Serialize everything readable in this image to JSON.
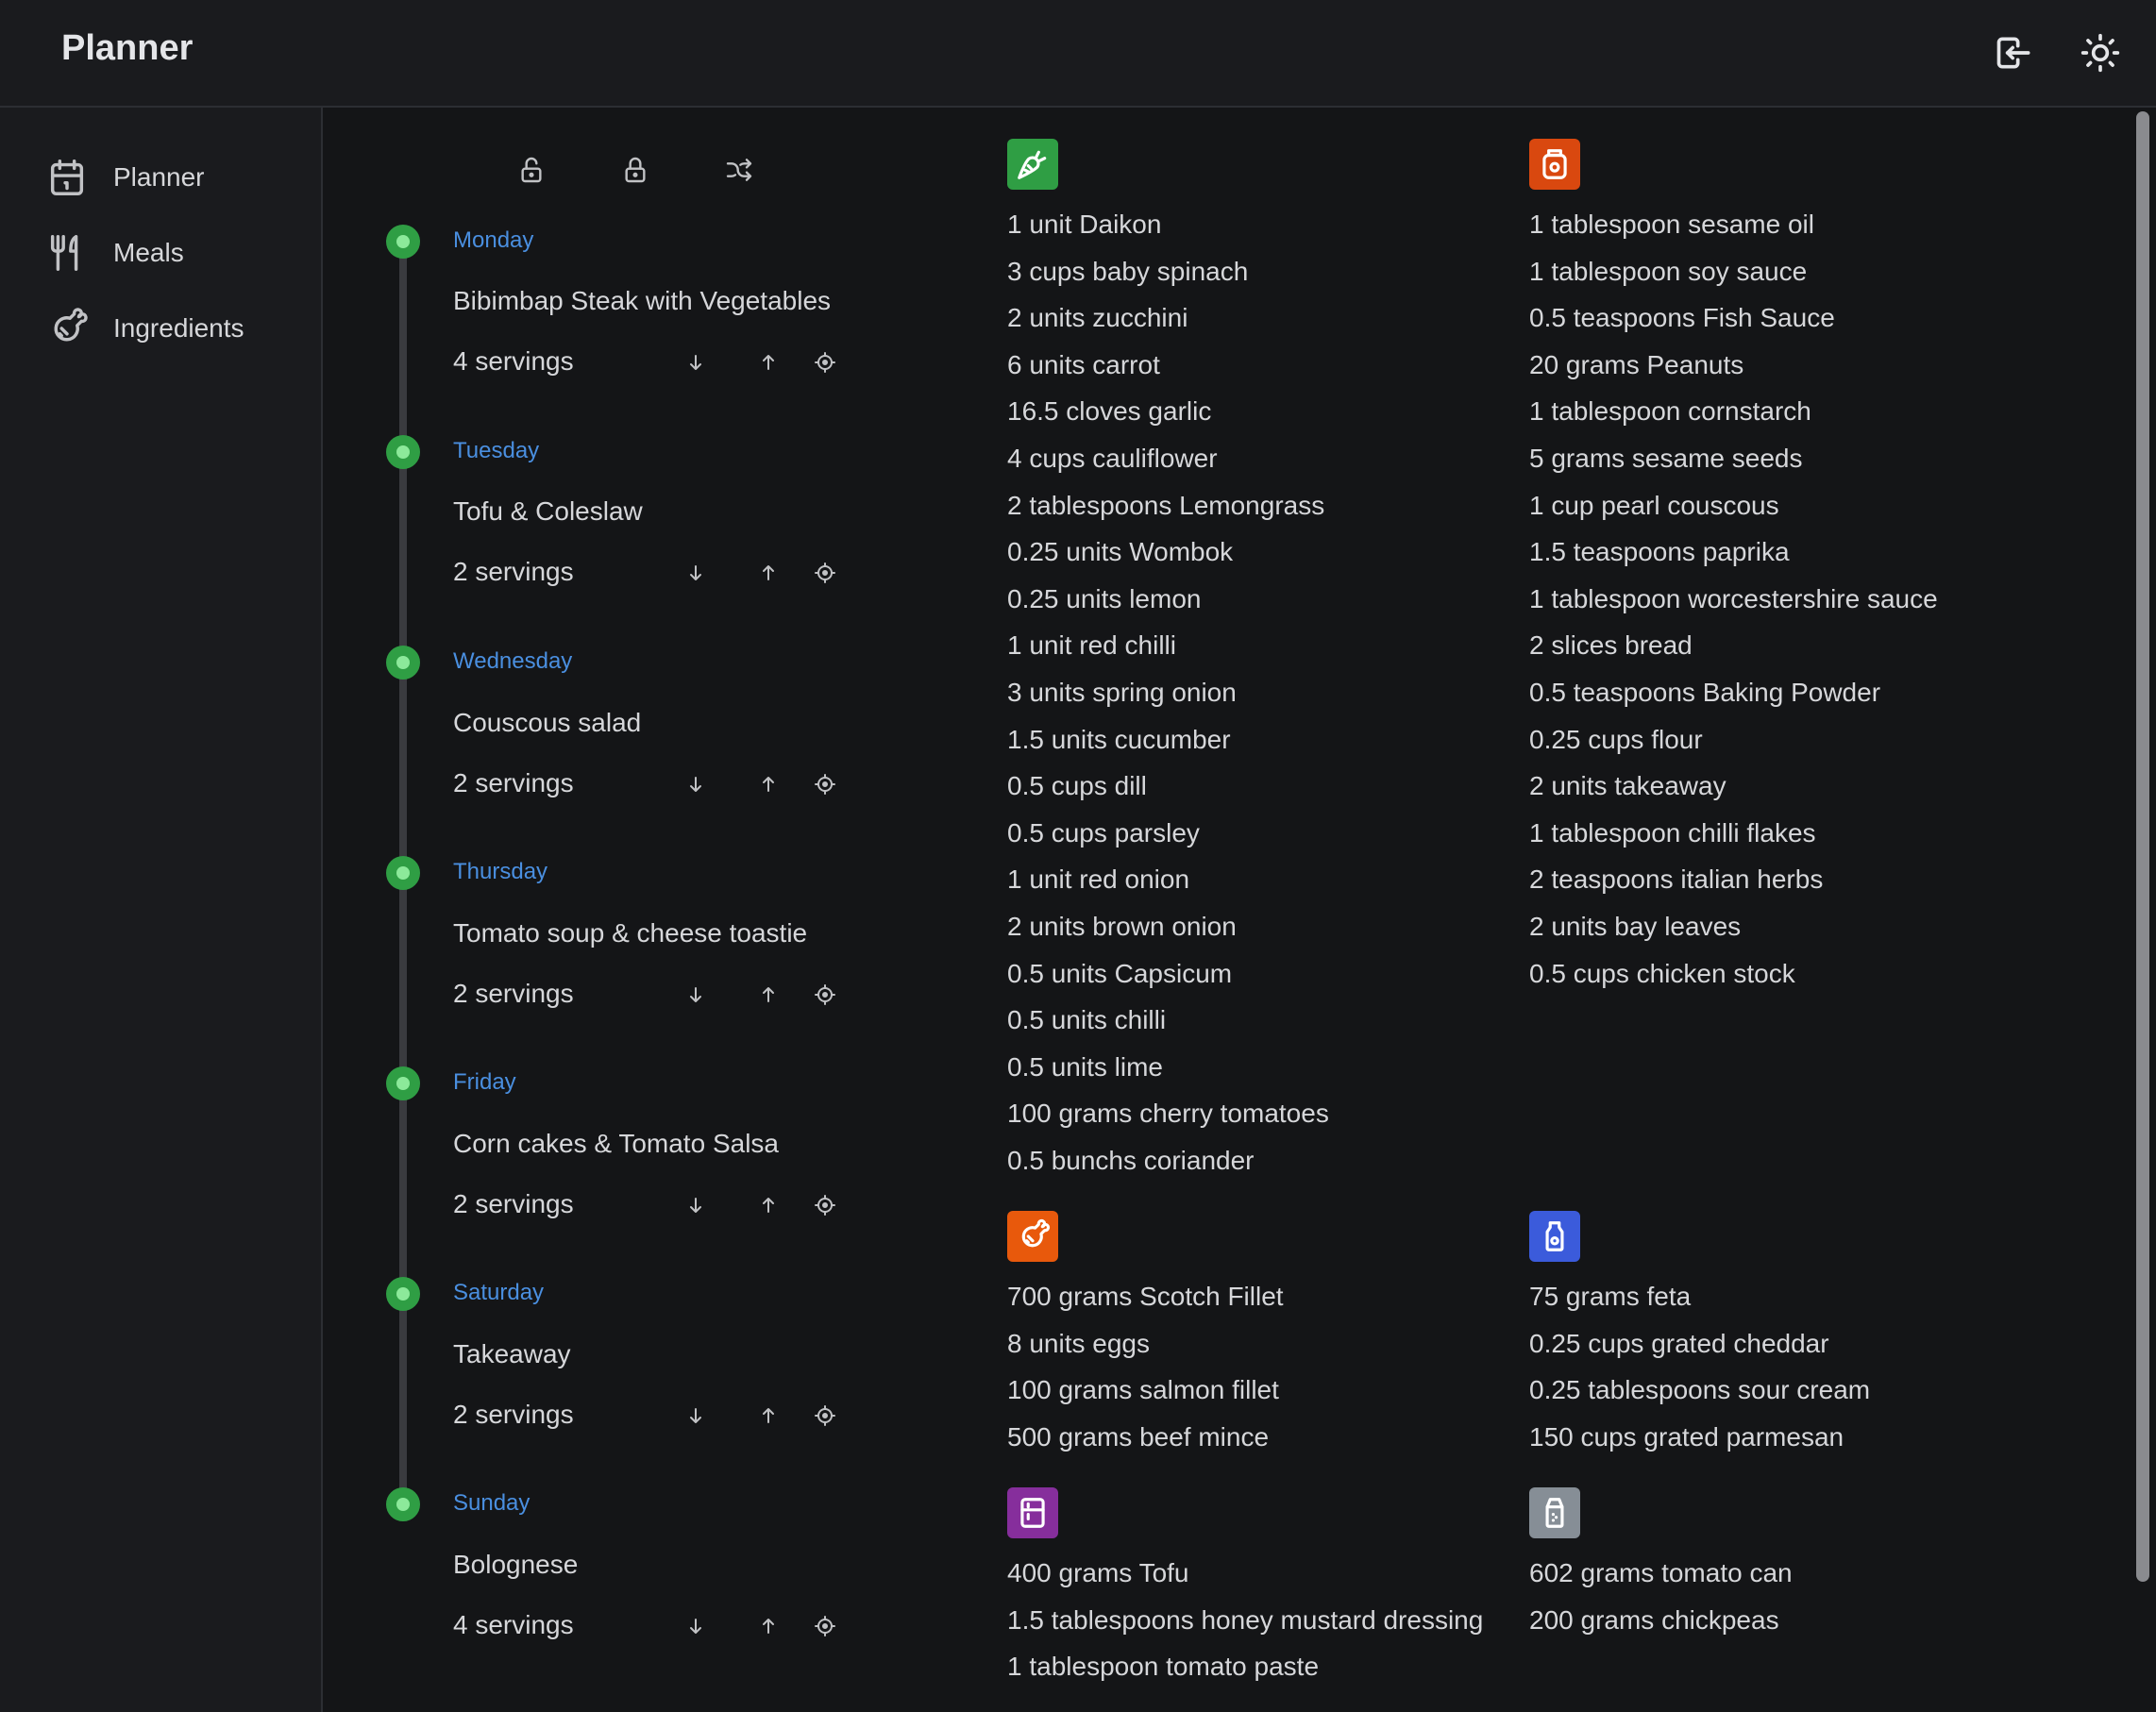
{
  "header": {
    "title": "Planner"
  },
  "sidebar": {
    "items": [
      {
        "label": "Planner",
        "icon": "calendar-icon"
      },
      {
        "label": "Meals",
        "icon": "fork-knife-icon"
      },
      {
        "label": "Ingredients",
        "icon": "meat-icon"
      }
    ]
  },
  "toolbar": {
    "icons": [
      "lock-open-icon",
      "lock-icon",
      "shuffle-icon"
    ]
  },
  "days": [
    {
      "day": "Monday",
      "meal": "Bibimbap Steak with Vegetables",
      "servings": "4 servings"
    },
    {
      "day": "Tuesday",
      "meal": "Tofu & Coleslaw",
      "servings": "2 servings"
    },
    {
      "day": "Wednesday",
      "meal": "Couscous salad",
      "servings": "2 servings"
    },
    {
      "day": "Thursday",
      "meal": "Tomato soup & cheese toastie",
      "servings": "2 servings"
    },
    {
      "day": "Friday",
      "meal": "Corn cakes & Tomato Salsa",
      "servings": "2 servings"
    },
    {
      "day": "Saturday",
      "meal": "Takeaway",
      "servings": "2 servings"
    },
    {
      "day": "Sunday",
      "meal": "Bolognese",
      "servings": "4 servings"
    }
  ],
  "categories": [
    {
      "icon": "carrot-icon",
      "color": "#2f9e44",
      "items": [
        "1 unit Daikon",
        "3 cups baby spinach",
        "2 units zucchini",
        "6 units carrot",
        "16.5 cloves garlic",
        "4 cups cauliflower",
        "2 tablespoons Lemongrass",
        "0.25 units Wombok",
        "0.25 units lemon",
        "1 unit red chilli",
        "3 units spring onion",
        "1.5 units cucumber",
        "0.5 cups dill",
        "0.5 cups parsley",
        "1 unit red onion",
        "2 units brown onion",
        "0.5 units Capsicum",
        "0.5 units chilli",
        "0.5 units lime",
        "100 grams cherry tomatoes",
        "0.5 bunchs coriander"
      ]
    },
    {
      "icon": "jar-icon",
      "color": "#d9480f",
      "items": [
        "1 tablespoon sesame oil",
        "1 tablespoon soy sauce",
        "0.5 teaspoons Fish Sauce",
        "20 grams Peanuts",
        "1 tablespoon cornstarch",
        "5 grams sesame seeds",
        "1 cup pearl couscous",
        "1.5 teaspoons paprika",
        "1 tablespoon worcestershire sauce",
        "2 slices bread",
        "0.5 teaspoons Baking Powder",
        "0.25 cups flour",
        "2 units takeaway",
        "1 tablespoon chilli flakes",
        "2 teaspoons italian herbs",
        "2 units bay leaves",
        "0.5 cups chicken stock"
      ]
    },
    {
      "icon": "meat-icon",
      "color": "#e8590c",
      "items": [
        "700 grams Scotch Fillet",
        "8 units eggs",
        "100 grams salmon fillet",
        "500 grams beef mince"
      ]
    },
    {
      "icon": "bottle-icon",
      "color": "#3b5bdb",
      "items": [
        "75 grams feta",
        "0.25 cups grated cheddar",
        "0.25 tablespoons sour cream",
        "150 cups grated parmesan"
      ]
    },
    {
      "icon": "fridge-icon",
      "color": "#862e9c",
      "items": [
        "400 grams Tofu",
        "1.5 tablespoons honey mustard dressing",
        "1 tablespoon tomato paste"
      ]
    },
    {
      "icon": "salt-icon",
      "color": "#868e96",
      "items": [
        "602 grams tomato can",
        "200 grams chickpeas"
      ]
    }
  ]
}
